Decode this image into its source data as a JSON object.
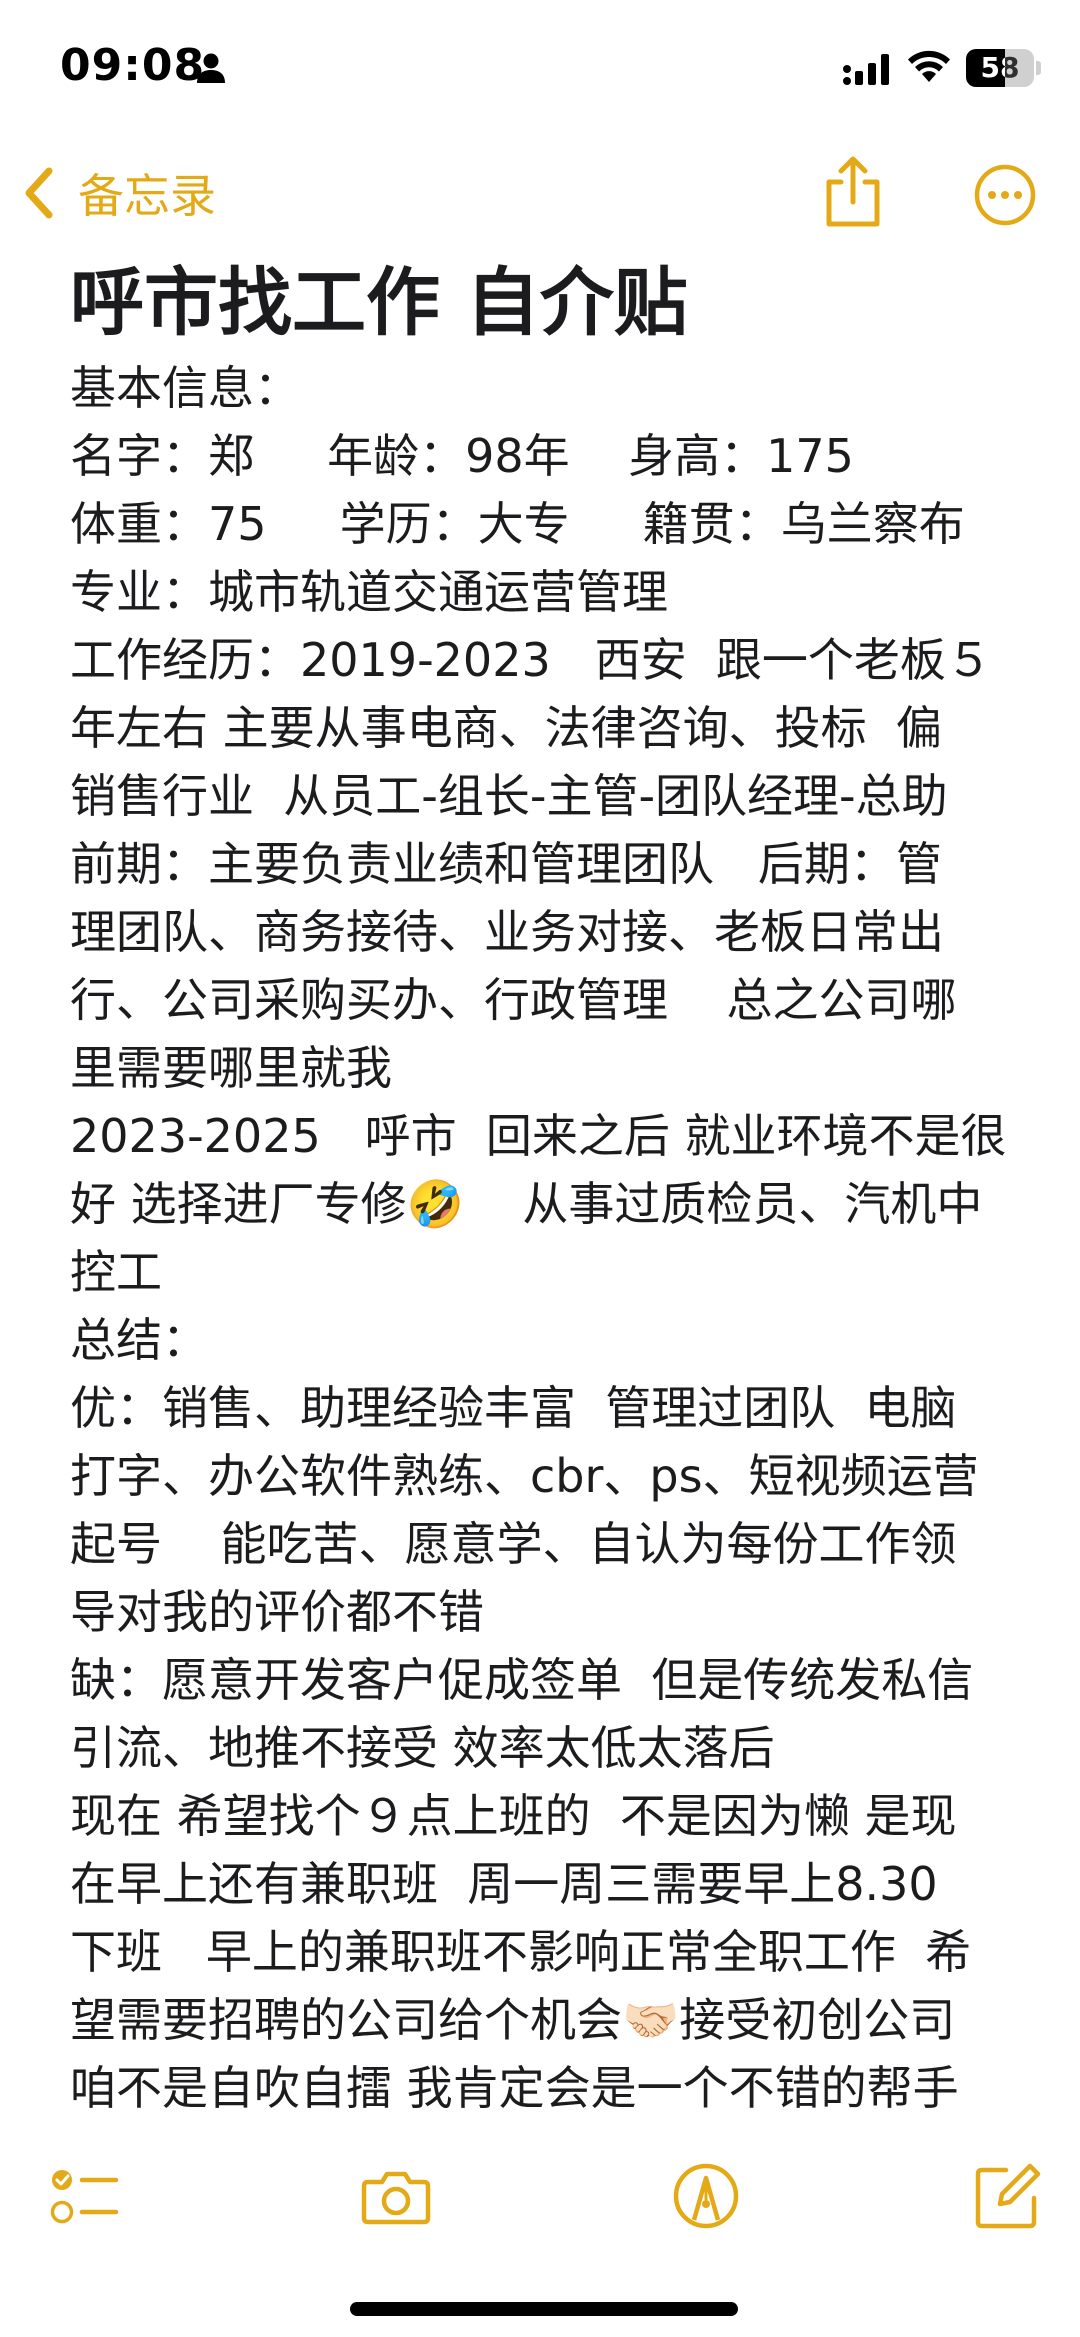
{
  "status_bar": {
    "time": "09:08",
    "battery": "58",
    "battery_level_percent": 58,
    "icons": [
      "person-icon",
      "cellular-signal-icon",
      "wifi-icon",
      "battery-icon"
    ]
  },
  "nav": {
    "back_label": "备忘录",
    "back_icon": "chevron-left-icon",
    "share_icon": "share-icon",
    "more_icon": "more-icon"
  },
  "note": {
    "title": "呼市找工作 自介贴",
    "lines": [
      "基本信息：",
      "名字：郑     年龄：98年    身高：175",
      "体重：75     学历：大专     籍贯：乌兰察布",
      "专业：城市轨道交通运营管理",
      "工作经历：2019-2023   西安  跟一个老板５",
      "年左右 主要从事电商、法律咨询、投标  偏",
      "销售行业  从员工-组长-主管-团队经理-总助",
      "前期：主要负责业绩和管理团队   后期：管",
      "理团队、商务接待、业务对接、老板日常出",
      "行、公司采购买办、行政管理    总之公司哪",
      "里需要哪里就我",
      "2023-2025   呼市  回来之后 就业环境不是很",
      "好 选择进厂专修🤣    从事过质检员、汽机中",
      "控工",
      "总结：",
      "优：销售、助理经验丰富  管理过团队  电脑",
      "打字、办公软件熟练、cbr、ps、短视频运营",
      "起号    能吃苦、愿意学、自认为每份工作领",
      "导对我的评价都不错",
      "缺：愿意开发客户促成签单  但是传统发私信",
      "引流、地推不接受 效率太低太落后",
      "现在 希望找个９点上班的  不是因为懒 是现",
      "在早上还有兼职班  周一周三需要早上8.30",
      "下班   早上的兼职班不影响正常全职工作  希",
      "望需要招聘的公司给个机会🤝🏻接受初创公司",
      "咱不是自吹自擂 我肯定会是一个不错的帮手"
    ]
  },
  "toolbar": {
    "icons": [
      "checklist-icon",
      "camera-icon",
      "markup-pen-icon",
      "compose-icon"
    ]
  },
  "colors": {
    "accent": "#e4a917",
    "text": "#1c1c1e",
    "background": "#ffffff"
  }
}
